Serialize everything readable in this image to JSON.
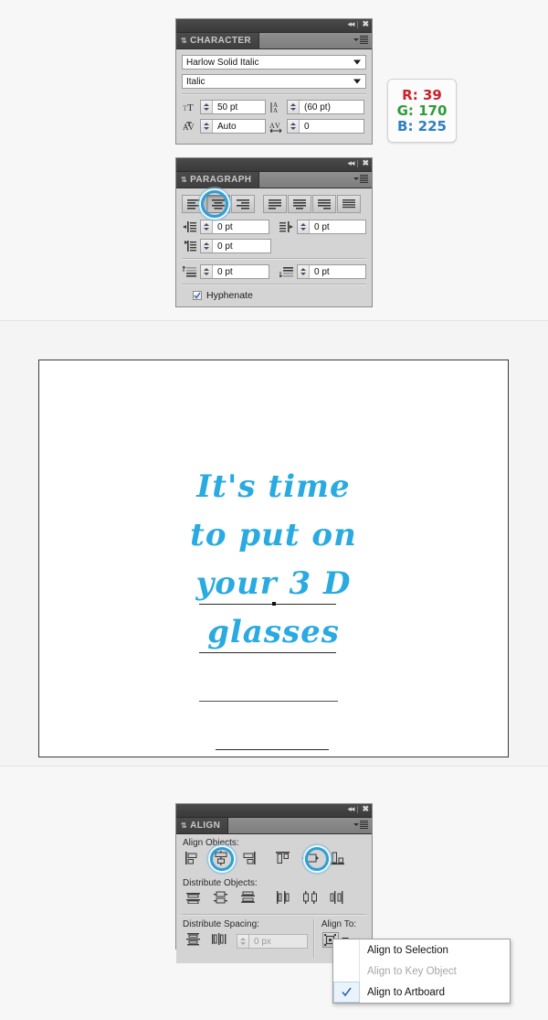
{
  "character_panel": {
    "tab_title": "CHARACTER",
    "font_family": "Harlow Solid Italic",
    "font_style": "Italic",
    "font_size": "50 pt",
    "leading": "(60 pt)",
    "kerning": "Auto",
    "tracking": "0"
  },
  "color_readout": {
    "r_label": "R: 39",
    "g_label": "G: 170",
    "b_label": "B: 225",
    "r_color": "#cc2229",
    "g_color": "#2f9c3a",
    "b_color": "#2f7fc1",
    "text_color": "#29aae1"
  },
  "paragraph_panel": {
    "tab_title": "PARAGRAPH",
    "align_buttons": [
      "align-left",
      "align-center",
      "align-right",
      "justify-last-left",
      "justify-last-center",
      "justify-last-right",
      "justify-all"
    ],
    "selected_align": "align-center",
    "left_indent": "0 pt",
    "right_indent": "0 pt",
    "first_line_indent": "0 pt",
    "space_before": "0 pt",
    "space_after": "0 pt",
    "hyphenate_label": "Hyphenate",
    "hyphenate_checked": true
  },
  "artwork": {
    "lines": [
      "It's time",
      "to put on",
      "your 3 D",
      "glasses"
    ]
  },
  "align_panel": {
    "tab_title": "ALIGN",
    "align_objects_label": "Align Objects:",
    "align_object_buttons": [
      "align-left-edges",
      "align-horizontal-center",
      "align-right-edges",
      "align-top-edges",
      "align-vertical-center",
      "align-bottom-edges"
    ],
    "highlighted_align_buttons": [
      "align-horizontal-center",
      "align-vertical-center"
    ],
    "distribute_objects_label": "Distribute Objects:",
    "distribute_object_buttons": [
      "distribute-top",
      "distribute-vertical-center",
      "distribute-bottom",
      "distribute-left",
      "distribute-horizontal-center",
      "distribute-right"
    ],
    "distribute_spacing_label": "Distribute Spacing:",
    "distribute_spacing_buttons": [
      "distribute-vertical-space",
      "distribute-horizontal-space"
    ],
    "spacing_value": "0 px",
    "align_to_label": "Align To:"
  },
  "align_to_menu": {
    "items": [
      {
        "label": "Align to Selection",
        "checked": false,
        "disabled": false
      },
      {
        "label": "Align to Key Object",
        "checked": false,
        "disabled": true
      },
      {
        "label": "Align to Artboard",
        "checked": true,
        "disabled": false
      }
    ]
  }
}
